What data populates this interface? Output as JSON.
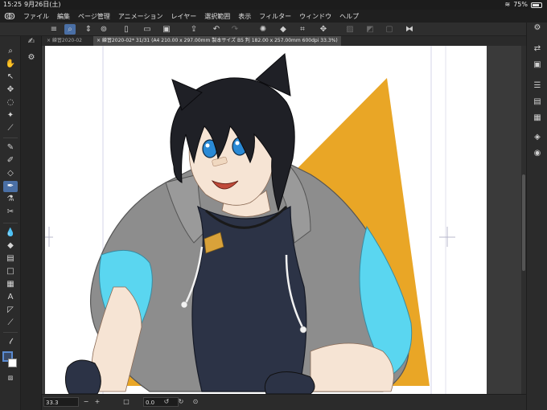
{
  "status": {
    "time": "15:25",
    "date": "9月26日(土)",
    "wifi": "wifi-icon",
    "battery_pct": "75%"
  },
  "menu": {
    "logo": "clip-studio-logo-icon",
    "items": [
      "ファイル",
      "編集",
      "ページ管理",
      "アニメーション",
      "レイヤー",
      "選択範囲",
      "表示",
      "フィルター",
      "ウィンドウ",
      "ヘルプ"
    ]
  },
  "tabs": [
    {
      "label": "× 練習2020-02",
      "active": false
    },
    {
      "label": "× 練習2020-02* 31/31 (A4 210.00 x 297.00mm 製本サイズ B5 判 182.00 x 257.00mm 600dpi 33.3%)",
      "active": true
    }
  ],
  "bottom": {
    "zoom": "33.3",
    "angle": "0.0"
  },
  "colors": {
    "accent": "#4a6fa5",
    "triangle": "#e9a626",
    "hair": "#1f2026",
    "eyes": "#2a8ad6",
    "hoodie_gray": "#8c8c8c",
    "hoodie_cyan": "#5ad6f0",
    "top": "#2c3346",
    "skin": "#f6e4d4",
    "tag": "#d9a23a"
  }
}
